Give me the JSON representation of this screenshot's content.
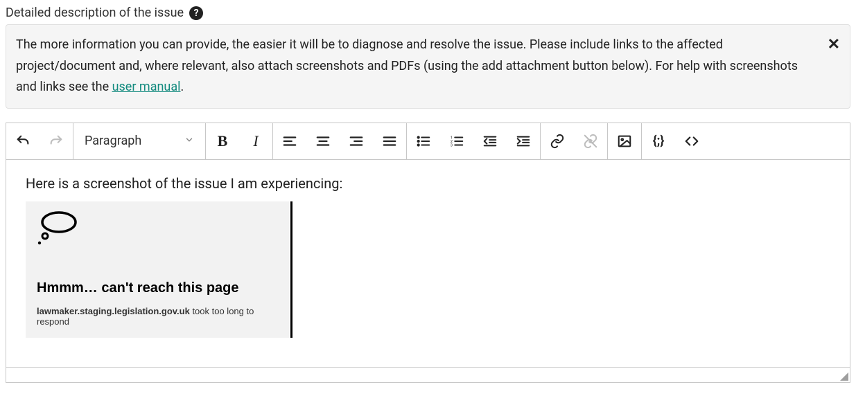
{
  "field": {
    "label": "Detailed description of the issue"
  },
  "info": {
    "text_part1": "The more information you can provide, the easier it will be to diagnose and resolve the issue.  Please include links to the affected project/document and, where relevant, also attach screenshots and PDFs (using the add attachment button below). For help with screenshots and links see the",
    "link_text": " user manual",
    "text_part2": "."
  },
  "toolbar": {
    "block_format": "Paragraph"
  },
  "content": {
    "line1": "Here is a screenshot of the issue I am experiencing:",
    "embedded_error": {
      "heading": "Hmmm… can't reach this page",
      "host": "lawmaker.staging.legislation.gov.uk",
      "rest": " took too long to respond"
    }
  }
}
